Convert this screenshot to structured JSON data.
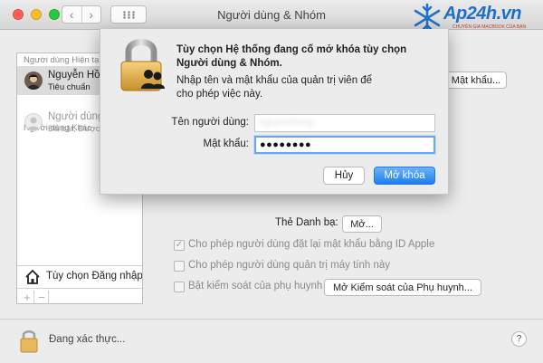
{
  "window": {
    "title": "Người dùng & Nhóm"
  },
  "logo": {
    "brand": "Ap24h.vn",
    "tagline": "CHUYÊN GIA MACBOOK CỦA BẠN"
  },
  "sidebar": {
    "current_section": "Người dùng Hiện tại",
    "current_user": {
      "name": "Nguyễn Hồng",
      "role": "Tiêu chuẩn"
    },
    "other_section": "Người dùng Khác",
    "other_user": {
      "name": "Người dùng",
      "status": "Đã bật, Được"
    },
    "login_options": "Tùy chọn Đăng nhập",
    "add": "+",
    "remove": "−"
  },
  "panel": {
    "change_password_button": "Mật khẩu...",
    "contacts_card_label": "Thẻ Danh bạ:",
    "contacts_open_button": "Mở...",
    "checkbox_reset_password": {
      "label": "Cho phép người dùng đặt lại mật khẩu bằng ID Apple",
      "checked": true
    },
    "checkbox_admin": {
      "label": "Cho phép người dùng quản trị máy tính này",
      "checked": false
    },
    "checkbox_parental": {
      "label": "Bật kiểm soát của phụ huynh",
      "checked": false
    },
    "parental_button": "Mở Kiểm soát của Phụ huynh..."
  },
  "bottom": {
    "auth_text": "Đang xác thực...",
    "help": "?"
  },
  "dialog": {
    "heading": "Tùy chọn Hệ thống đang cố mở khóa tùy chọn Người dùng & Nhóm.",
    "description": "Nhập tên và mật khẩu của quản trị viên để cho phép việc này.",
    "username_label": "Tên người dùng:",
    "username_value": "nguyenhong",
    "password_label": "Mật khẩu:",
    "password_value": "●●●●●●●●",
    "cancel_button": "Hủy",
    "unlock_button": "Mở khóa"
  },
  "colors": {
    "accent": "#1c7ef0",
    "focus_ring": "#6aa7ee",
    "logo_blue": "#1f6fc9"
  }
}
